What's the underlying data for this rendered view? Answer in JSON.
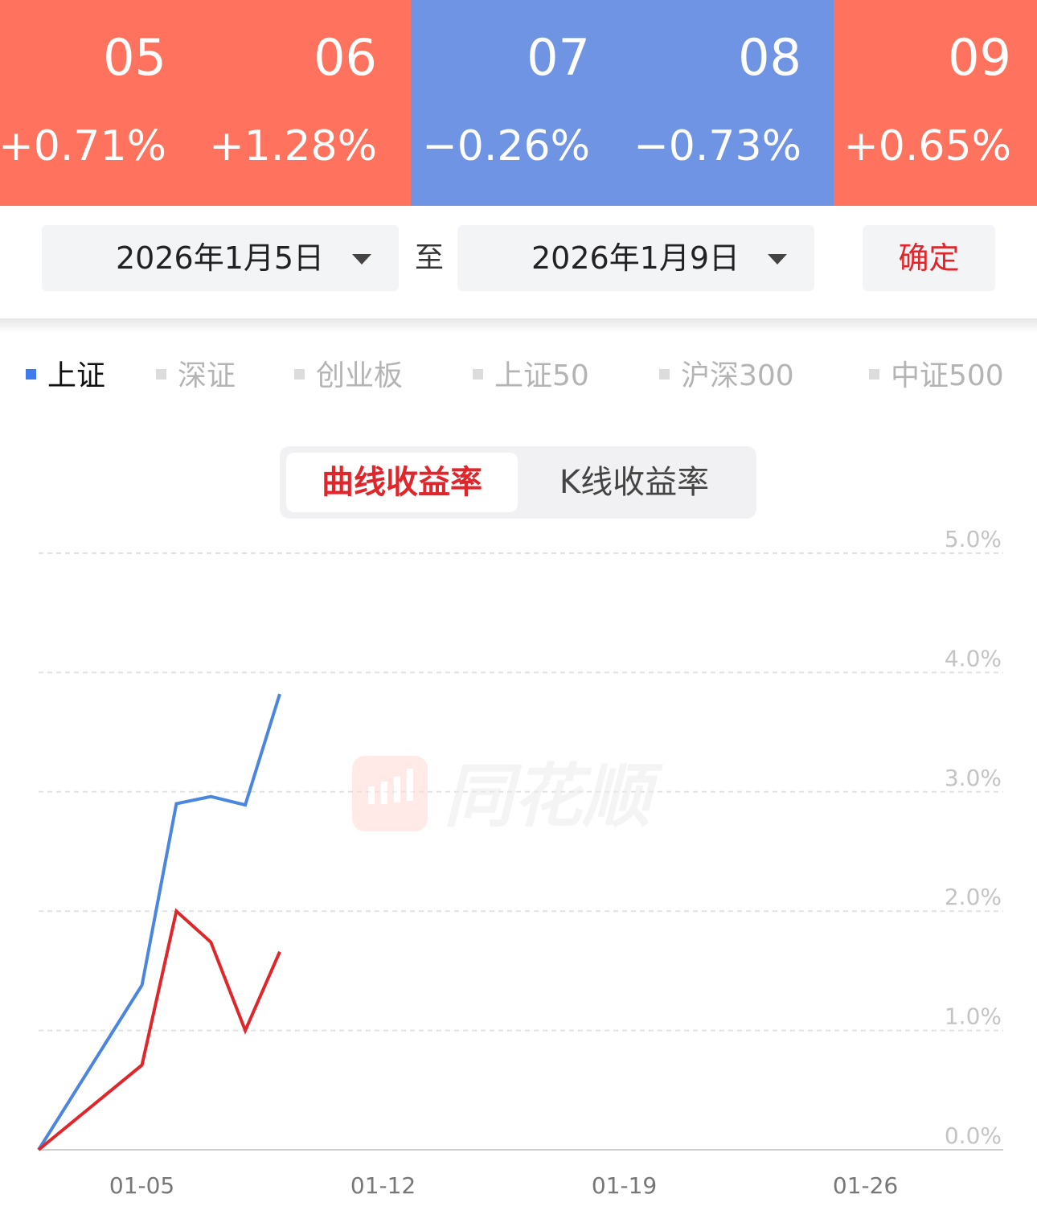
{
  "day_tiles": [
    {
      "day": "05",
      "change": "+0.71%",
      "color": "#ff735e"
    },
    {
      "day": "06",
      "change": "+1.28%",
      "color": "#ff735e"
    },
    {
      "day": "07",
      "change": "−0.26%",
      "color": "#7094e4"
    },
    {
      "day": "08",
      "change": "−0.73%",
      "color": "#7094e4"
    },
    {
      "day": "09",
      "change": "+0.65%",
      "color": "#ff735e"
    }
  ],
  "date_range": {
    "start": "2026年1月5日",
    "separator": "至",
    "end": "2026年1月9日",
    "confirm_label": "确定"
  },
  "index_tabs": [
    {
      "label": "上证",
      "active": true
    },
    {
      "label": "深证",
      "active": false
    },
    {
      "label": "创业板",
      "active": false
    },
    {
      "label": "上证50",
      "active": false
    },
    {
      "label": "沪深300",
      "active": false
    },
    {
      "label": "中证500",
      "active": false
    }
  ],
  "chart_mode_toggle": {
    "options": [
      "曲线收益率",
      "K线收益率"
    ],
    "selected": "曲线收益率",
    "selected_color": "#e0262b"
  },
  "watermark": {
    "text": "同花顺"
  },
  "chart_data": {
    "type": "line",
    "x_ticks": [
      "01-05",
      "01-12",
      "01-19",
      "01-26"
    ],
    "y_ticks": [
      "0.0%",
      "1.0%",
      "2.0%",
      "3.0%",
      "4.0%",
      "5.0%"
    ],
    "ylim": [
      0,
      5
    ],
    "y_axis_side": "right",
    "grid": true,
    "x_start": "2026-01-02",
    "x_end": "2026-01-30",
    "series": [
      {
        "color": "#4a86e0",
        "points": [
          {
            "x": "2026-01-02",
            "y": 0.0
          },
          {
            "x": "2026-01-05",
            "y": 1.38
          },
          {
            "x": "2026-01-06",
            "y": 2.9
          },
          {
            "x": "2026-01-07",
            "y": 2.96
          },
          {
            "x": "2026-01-08",
            "y": 2.89
          },
          {
            "x": "2026-01-09",
            "y": 3.82
          }
        ]
      },
      {
        "color": "#e0262b",
        "points": [
          {
            "x": "2026-01-02",
            "y": 0.0
          },
          {
            "x": "2026-01-05",
            "y": 0.71
          },
          {
            "x": "2026-01-06",
            "y": 2.0
          },
          {
            "x": "2026-01-07",
            "y": 1.74
          },
          {
            "x": "2026-01-08",
            "y": 1.0
          },
          {
            "x": "2026-01-09",
            "y": 1.66
          }
        ]
      }
    ]
  }
}
